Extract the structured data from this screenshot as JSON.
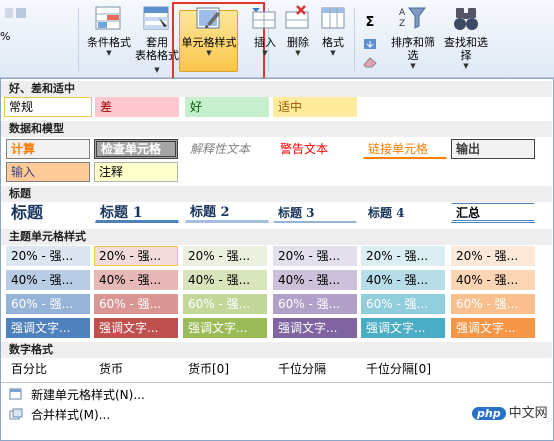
{
  "ribbon": {
    "left_text": "%",
    "conditional_format": "条件格式",
    "table_format_1": "套用",
    "table_format_2": "表格格式",
    "cell_styles": "单元格样式",
    "insert": "插入",
    "delete": "删除",
    "format": "格式",
    "sigma": "Σ",
    "sort_filter": "排序和筛选",
    "find_select": "查找和选择"
  },
  "sections": {
    "good_bad": "好、差和适中",
    "data_model": "数据和模型",
    "titles": "标题",
    "theme": "主题单元格样式",
    "number": "数字格式"
  },
  "good_bad": [
    "常规",
    "差",
    "好",
    "适中"
  ],
  "data_model_row1": [
    "计算",
    "检查单元格",
    "解释性文本",
    "警告文本",
    "链接单元格",
    "输出"
  ],
  "data_model_row2": [
    "输入",
    "注释"
  ],
  "titles": [
    "标题",
    "标题 1",
    "标题 2",
    "标题 3",
    "标题 4",
    "汇总"
  ],
  "theme_rows": [
    [
      "20% - 强...",
      "20% - 强...",
      "20% - 强...",
      "20% - 强...",
      "20% - 强...",
      "20% - 强..."
    ],
    [
      "40% - 强...",
      "40% - 强...",
      "40% - 强...",
      "40% - 强...",
      "40% - 强...",
      "40% - 强..."
    ],
    [
      "60% - 强...",
      "60% - 强...",
      "60% - 强...",
      "60% - 强...",
      "60% - 强...",
      "60% - 强..."
    ],
    [
      "强调文字...",
      "强调文字...",
      "强调文字...",
      "强调文字...",
      "强调文字...",
      "强调文字..."
    ]
  ],
  "number_formats": [
    "百分比",
    "货币",
    "货币[0]",
    "千位分隔",
    "千位分隔[0]"
  ],
  "footer": {
    "new_style": "新建单元格样式(N)...",
    "merge_style": "合并样式(M)..."
  },
  "watermark": {
    "logo": "php",
    "text": "中文网"
  }
}
